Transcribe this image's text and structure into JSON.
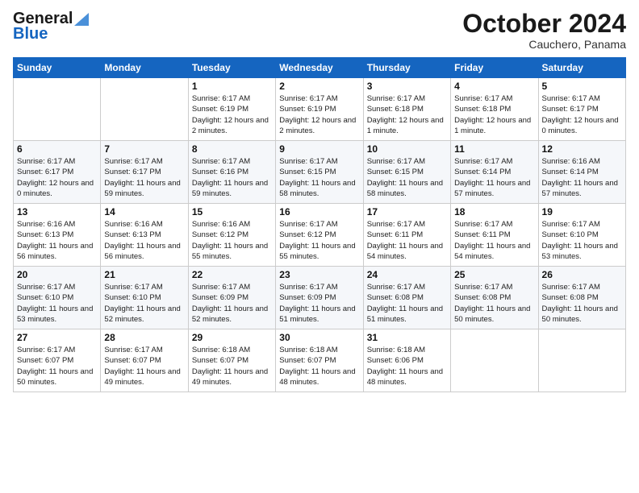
{
  "logo": {
    "line1": "General",
    "line2": "Blue"
  },
  "title": "October 2024",
  "location": "Cauchero, Panama",
  "days_header": [
    "Sunday",
    "Monday",
    "Tuesday",
    "Wednesday",
    "Thursday",
    "Friday",
    "Saturday"
  ],
  "weeks": [
    [
      {
        "day": "",
        "sunrise": "",
        "sunset": "",
        "daylight": ""
      },
      {
        "day": "",
        "sunrise": "",
        "sunset": "",
        "daylight": ""
      },
      {
        "day": "1",
        "sunrise": "Sunrise: 6:17 AM",
        "sunset": "Sunset: 6:19 PM",
        "daylight": "Daylight: 12 hours and 2 minutes."
      },
      {
        "day": "2",
        "sunrise": "Sunrise: 6:17 AM",
        "sunset": "Sunset: 6:19 PM",
        "daylight": "Daylight: 12 hours and 2 minutes."
      },
      {
        "day": "3",
        "sunrise": "Sunrise: 6:17 AM",
        "sunset": "Sunset: 6:18 PM",
        "daylight": "Daylight: 12 hours and 1 minute."
      },
      {
        "day": "4",
        "sunrise": "Sunrise: 6:17 AM",
        "sunset": "Sunset: 6:18 PM",
        "daylight": "Daylight: 12 hours and 1 minute."
      },
      {
        "day": "5",
        "sunrise": "Sunrise: 6:17 AM",
        "sunset": "Sunset: 6:17 PM",
        "daylight": "Daylight: 12 hours and 0 minutes."
      }
    ],
    [
      {
        "day": "6",
        "sunrise": "Sunrise: 6:17 AM",
        "sunset": "Sunset: 6:17 PM",
        "daylight": "Daylight: 12 hours and 0 minutes."
      },
      {
        "day": "7",
        "sunrise": "Sunrise: 6:17 AM",
        "sunset": "Sunset: 6:17 PM",
        "daylight": "Daylight: 11 hours and 59 minutes."
      },
      {
        "day": "8",
        "sunrise": "Sunrise: 6:17 AM",
        "sunset": "Sunset: 6:16 PM",
        "daylight": "Daylight: 11 hours and 59 minutes."
      },
      {
        "day": "9",
        "sunrise": "Sunrise: 6:17 AM",
        "sunset": "Sunset: 6:15 PM",
        "daylight": "Daylight: 11 hours and 58 minutes."
      },
      {
        "day": "10",
        "sunrise": "Sunrise: 6:17 AM",
        "sunset": "Sunset: 6:15 PM",
        "daylight": "Daylight: 11 hours and 58 minutes."
      },
      {
        "day": "11",
        "sunrise": "Sunrise: 6:17 AM",
        "sunset": "Sunset: 6:14 PM",
        "daylight": "Daylight: 11 hours and 57 minutes."
      },
      {
        "day": "12",
        "sunrise": "Sunrise: 6:16 AM",
        "sunset": "Sunset: 6:14 PM",
        "daylight": "Daylight: 11 hours and 57 minutes."
      }
    ],
    [
      {
        "day": "13",
        "sunrise": "Sunrise: 6:16 AM",
        "sunset": "Sunset: 6:13 PM",
        "daylight": "Daylight: 11 hours and 56 minutes."
      },
      {
        "day": "14",
        "sunrise": "Sunrise: 6:16 AM",
        "sunset": "Sunset: 6:13 PM",
        "daylight": "Daylight: 11 hours and 56 minutes."
      },
      {
        "day": "15",
        "sunrise": "Sunrise: 6:16 AM",
        "sunset": "Sunset: 6:12 PM",
        "daylight": "Daylight: 11 hours and 55 minutes."
      },
      {
        "day": "16",
        "sunrise": "Sunrise: 6:17 AM",
        "sunset": "Sunset: 6:12 PM",
        "daylight": "Daylight: 11 hours and 55 minutes."
      },
      {
        "day": "17",
        "sunrise": "Sunrise: 6:17 AM",
        "sunset": "Sunset: 6:11 PM",
        "daylight": "Daylight: 11 hours and 54 minutes."
      },
      {
        "day": "18",
        "sunrise": "Sunrise: 6:17 AM",
        "sunset": "Sunset: 6:11 PM",
        "daylight": "Daylight: 11 hours and 54 minutes."
      },
      {
        "day": "19",
        "sunrise": "Sunrise: 6:17 AM",
        "sunset": "Sunset: 6:10 PM",
        "daylight": "Daylight: 11 hours and 53 minutes."
      }
    ],
    [
      {
        "day": "20",
        "sunrise": "Sunrise: 6:17 AM",
        "sunset": "Sunset: 6:10 PM",
        "daylight": "Daylight: 11 hours and 53 minutes."
      },
      {
        "day": "21",
        "sunrise": "Sunrise: 6:17 AM",
        "sunset": "Sunset: 6:10 PM",
        "daylight": "Daylight: 11 hours and 52 minutes."
      },
      {
        "day": "22",
        "sunrise": "Sunrise: 6:17 AM",
        "sunset": "Sunset: 6:09 PM",
        "daylight": "Daylight: 11 hours and 52 minutes."
      },
      {
        "day": "23",
        "sunrise": "Sunrise: 6:17 AM",
        "sunset": "Sunset: 6:09 PM",
        "daylight": "Daylight: 11 hours and 51 minutes."
      },
      {
        "day": "24",
        "sunrise": "Sunrise: 6:17 AM",
        "sunset": "Sunset: 6:08 PM",
        "daylight": "Daylight: 11 hours and 51 minutes."
      },
      {
        "day": "25",
        "sunrise": "Sunrise: 6:17 AM",
        "sunset": "Sunset: 6:08 PM",
        "daylight": "Daylight: 11 hours and 50 minutes."
      },
      {
        "day": "26",
        "sunrise": "Sunrise: 6:17 AM",
        "sunset": "Sunset: 6:08 PM",
        "daylight": "Daylight: 11 hours and 50 minutes."
      }
    ],
    [
      {
        "day": "27",
        "sunrise": "Sunrise: 6:17 AM",
        "sunset": "Sunset: 6:07 PM",
        "daylight": "Daylight: 11 hours and 50 minutes."
      },
      {
        "day": "28",
        "sunrise": "Sunrise: 6:17 AM",
        "sunset": "Sunset: 6:07 PM",
        "daylight": "Daylight: 11 hours and 49 minutes."
      },
      {
        "day": "29",
        "sunrise": "Sunrise: 6:18 AM",
        "sunset": "Sunset: 6:07 PM",
        "daylight": "Daylight: 11 hours and 49 minutes."
      },
      {
        "day": "30",
        "sunrise": "Sunrise: 6:18 AM",
        "sunset": "Sunset: 6:07 PM",
        "daylight": "Daylight: 11 hours and 48 minutes."
      },
      {
        "day": "31",
        "sunrise": "Sunrise: 6:18 AM",
        "sunset": "Sunset: 6:06 PM",
        "daylight": "Daylight: 11 hours and 48 minutes."
      },
      {
        "day": "",
        "sunrise": "",
        "sunset": "",
        "daylight": ""
      },
      {
        "day": "",
        "sunrise": "",
        "sunset": "",
        "daylight": ""
      }
    ]
  ]
}
